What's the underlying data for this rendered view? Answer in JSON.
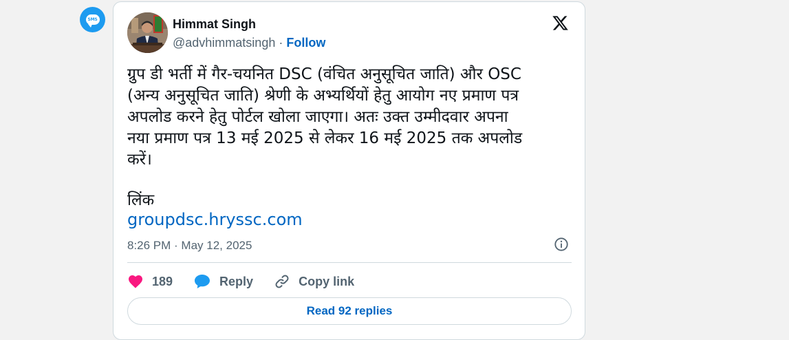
{
  "notification": {
    "badge_text": "SMS"
  },
  "tweet": {
    "author": {
      "name": "Himmat Singh",
      "handle": "@advhimmatsingh",
      "separator": "·",
      "follow_label": "Follow"
    },
    "text": "ग्रुप डी भर्ती में गैर-चयनित DSC (वंचित अनुसूचित जाति) और OSC\n(अन्य अनुसूचित जाति) श्रेणी के अभ्यर्थियों हेतु आयोग नए प्रमाण पत्र\nअपलोड करने हेतु पोर्टल खोला जाएगा। अतः उक्त उम्मीदवार अपना\nनया प्रमाण पत्र 13 मई 2025 से लेकर 16 मई 2025 तक अपलोड\nकरें।",
    "link_label": "लिंक",
    "link_url": "groupdsc.hryssc.com",
    "timestamp": "8:26 PM · May 12, 2025",
    "actions": {
      "likes": "189",
      "reply_label": "Reply",
      "copy_link_label": "Copy link"
    },
    "read_replies_label": "Read 92 replies"
  },
  "colors": {
    "accent": "#1d9bf0",
    "link": "#0066c2",
    "like": "#f91880",
    "text": "#0f1419",
    "muted": "#536471",
    "border": "#cfd9de"
  }
}
